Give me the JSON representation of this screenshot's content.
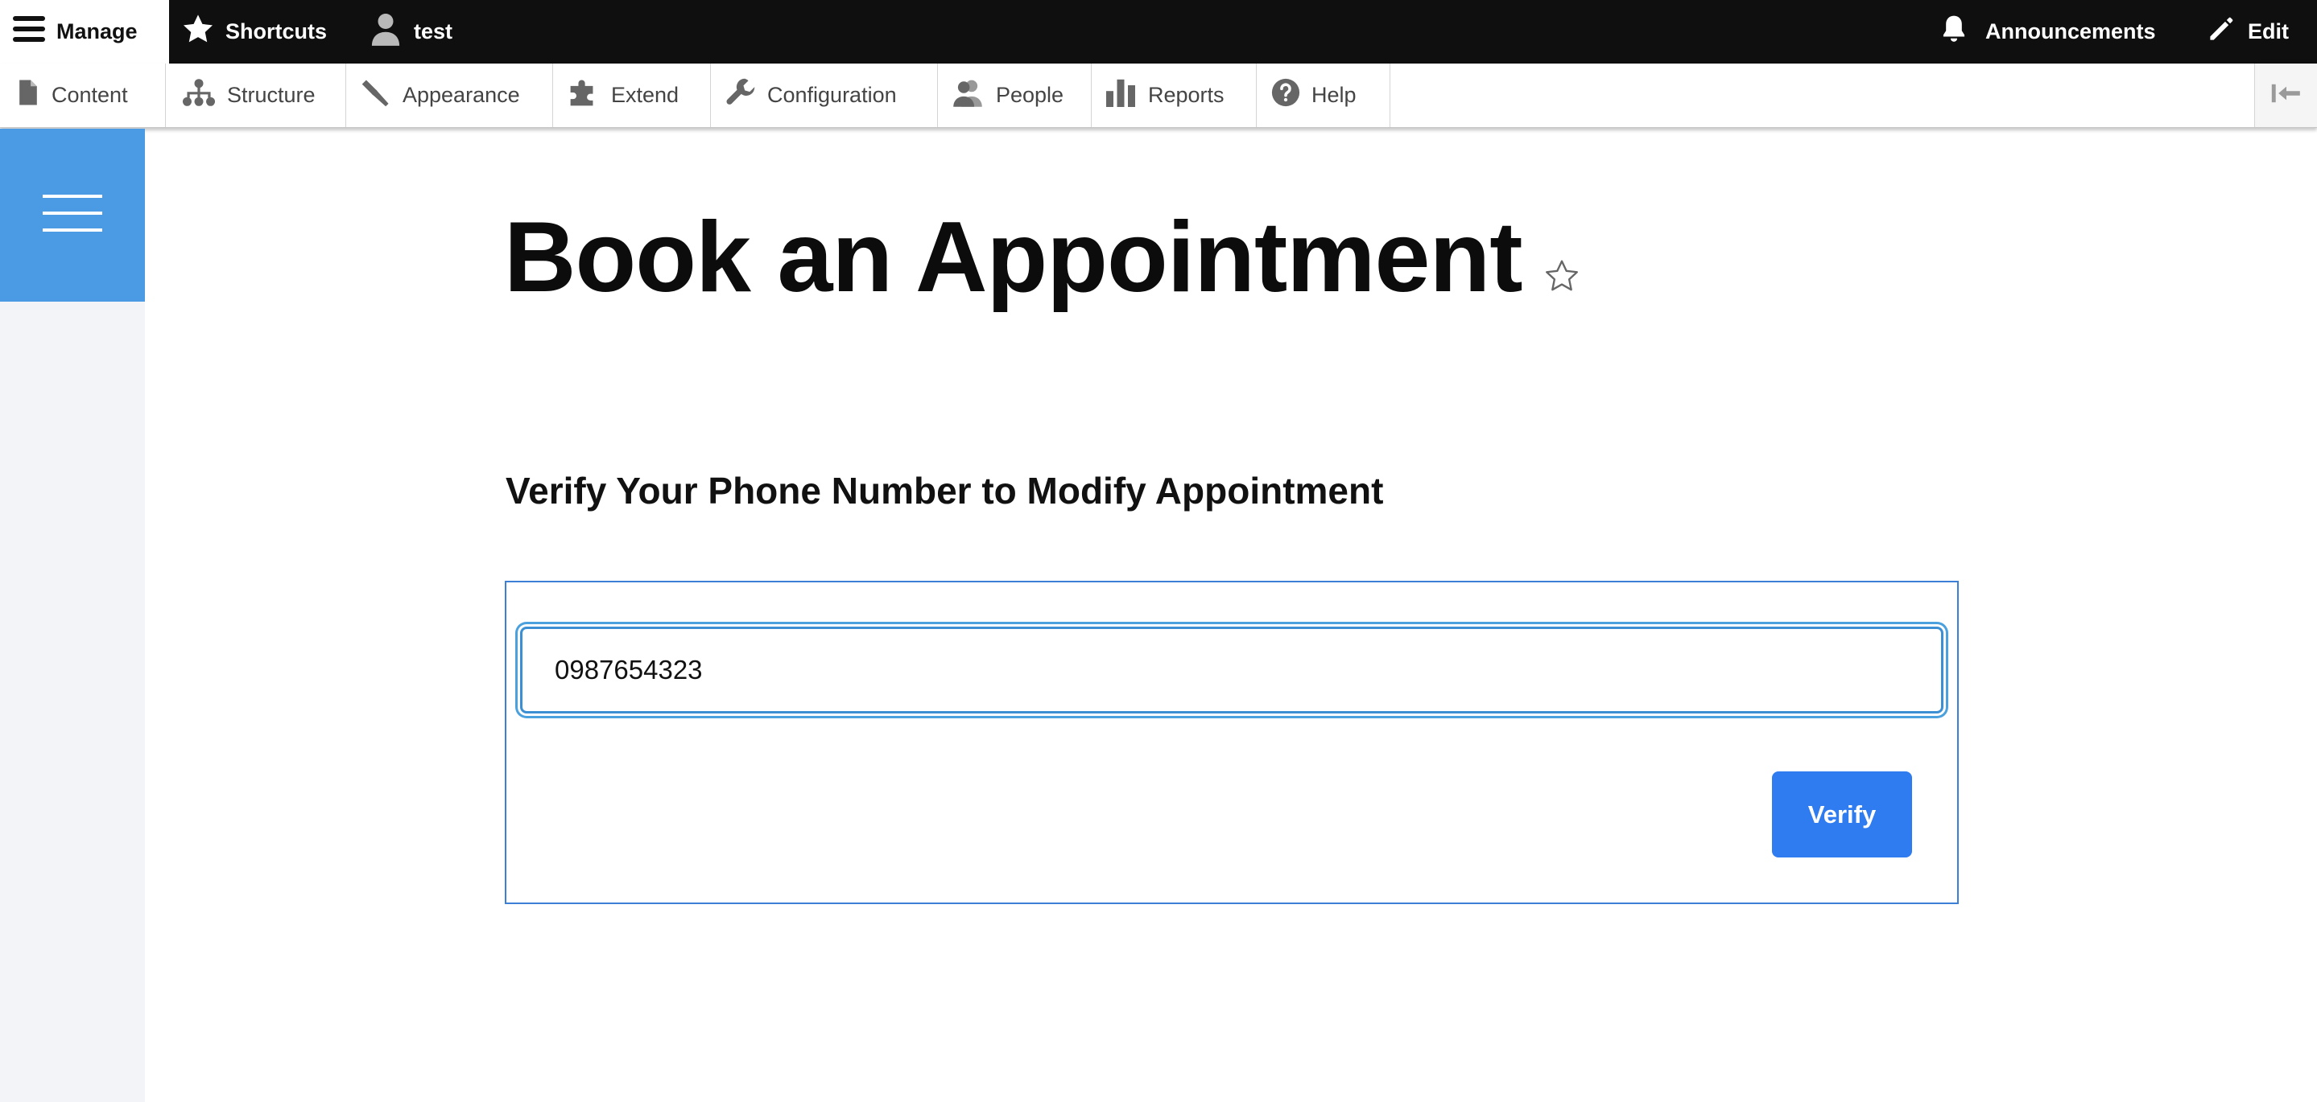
{
  "toolbar": {
    "manage_label": "Manage",
    "shortcuts_label": "Shortcuts",
    "user_label": "test",
    "announcements_label": "Announcements",
    "edit_label": "Edit"
  },
  "admin_menu": {
    "items": [
      {
        "label": "Content",
        "icon": "file-icon"
      },
      {
        "label": "Structure",
        "icon": "sitemap-icon"
      },
      {
        "label": "Appearance",
        "icon": "paint-brush-icon"
      },
      {
        "label": "Extend",
        "icon": "puzzle-icon"
      },
      {
        "label": "Configuration",
        "icon": "wrench-icon"
      },
      {
        "label": "People",
        "icon": "people-icon"
      },
      {
        "label": "Reports",
        "icon": "bar-chart-icon"
      },
      {
        "label": "Help",
        "icon": "help-icon"
      }
    ],
    "toggle_icon": "collapse-tray-icon"
  },
  "sidebar": {
    "menu_icon": "hamburger-icon"
  },
  "main": {
    "title": "Book an Appointment",
    "subtitle": "Verify Your Phone Number to Modify Appointment",
    "phone_value": "0987654323",
    "verify_label": "Verify"
  },
  "colors": {
    "toolbar_bg": "#0f0f0f",
    "accent_blue": "#2f7bf0",
    "sidebar_blue": "#4b9ae4",
    "sidebar_bg": "#f3f4f7",
    "focus_ring": "#4ba0de"
  }
}
